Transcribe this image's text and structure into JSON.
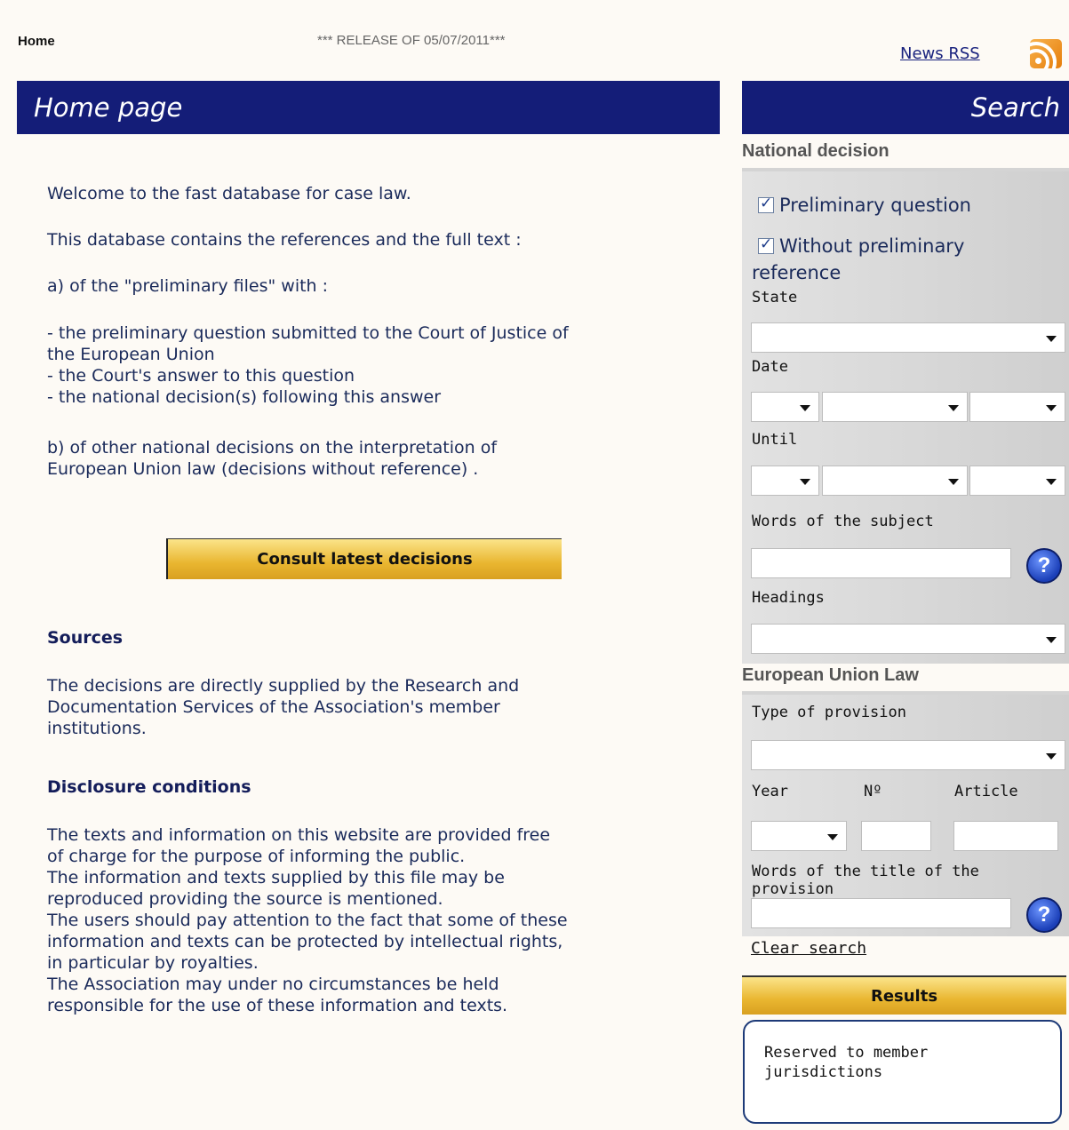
{
  "top": {
    "home": "Home",
    "release": "*** RELEASE OF 05/07/2011***",
    "rss_link": "News RSS",
    "rss_icon": "rss-icon"
  },
  "main": {
    "header": "Home page",
    "welcome": "Welcome to the fast database for case law.",
    "contains": "This database contains the references and the full text :",
    "a_label": "a) of the \"preliminary files\" with :",
    "a_items": [
      "- the preliminary question submitted to the Court of Justice of",
      "the European Union",
      "- the Court's answer to this question",
      "- the national decision(s) following this answer"
    ],
    "b_lines": [
      "b) of other national decisions on the interpretation of",
      "European Union law (decisions without reference) ."
    ],
    "consult_button": "Consult latest decisions",
    "sources_title": "Sources",
    "sources_lines": [
      "The decisions are directly supplied by the Research and",
      "Documentation Services of the Association's member",
      "institutions."
    ],
    "disclosure_title": "Disclosure conditions",
    "disclosure_lines": [
      "The texts and information on this website are provided free",
      "of charge for the purpose of informing the public.",
      "The information and texts supplied by this file may be",
      "reproduced providing the source is mentioned.",
      "The users should pay attention to the fact that some of these",
      "information and texts can be protected by intellectual rights,",
      "in particular by royalties.",
      "The Association may under no circumstances be held",
      "responsible for the use of these information and texts."
    ]
  },
  "sidebar": {
    "header": "Search",
    "national_title": "National decision",
    "preliminary_question": "Preliminary question",
    "preliminary_question_checked": true,
    "without_reference_1": "Without preliminary",
    "without_reference_2": "reference",
    "without_reference_checked": true,
    "state_label": "State",
    "date_label": "Date",
    "until_label": "Until",
    "words_subject_label": "Words of the subject",
    "headings_label": "Headings",
    "eu_law_title": "European Union Law",
    "type_provision_label": "Type of provision",
    "year_label": "Year",
    "no_label": "Nº",
    "article_label": "Article",
    "words_title_label": "Words of the title of the provision",
    "help_glyph": "?",
    "clear_search": "Clear search",
    "results_button": "Results",
    "reserved_text": "Reserved to member jurisdictions"
  },
  "colors": {
    "header_bg": "#141d78",
    "button_gold": "#e9b630",
    "panel_gray": "#d8d8d8",
    "text_navy": "#1a2a5a"
  }
}
